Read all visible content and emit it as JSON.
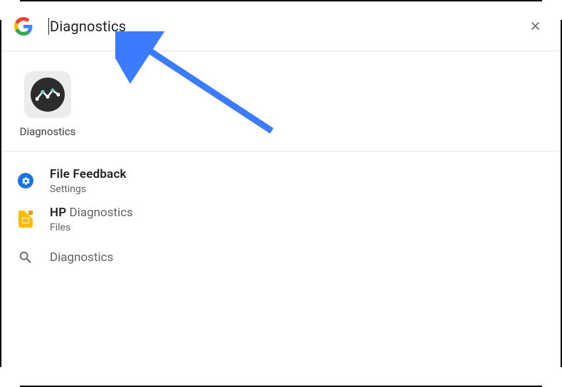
{
  "search": {
    "query": "Diagnostics"
  },
  "app": {
    "label": "Diagnostics"
  },
  "results": [
    {
      "title_bold": "File Feedback",
      "title_rest": "",
      "sub": "Settings"
    },
    {
      "title_bold": "HP",
      "title_rest": " Diagnostics",
      "sub": "Files"
    }
  ],
  "suggestion": {
    "text": "Diagnostics"
  }
}
